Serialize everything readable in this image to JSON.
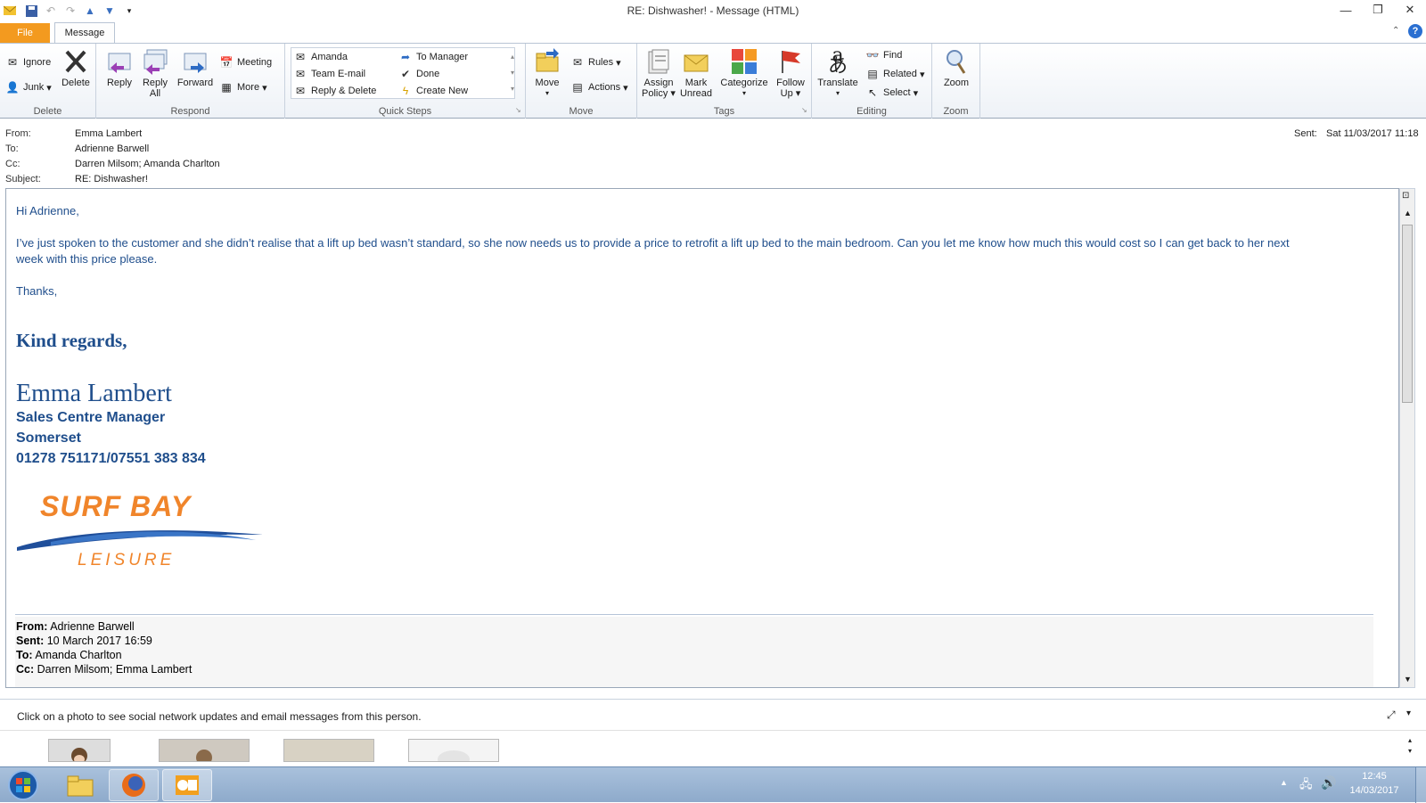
{
  "window": {
    "title": "RE: Dishwasher!  -  Message (HTML)"
  },
  "tabs": {
    "file": "File",
    "message": "Message"
  },
  "ribbon": {
    "delete_group": {
      "label": "Delete",
      "ignore": "Ignore",
      "junk": "Junk",
      "delete": "Delete"
    },
    "respond_group": {
      "label": "Respond",
      "reply": "Reply",
      "reply_all_1": "Reply",
      "reply_all_2": "All",
      "forward": "Forward",
      "meeting": "Meeting",
      "more": "More"
    },
    "quicksteps_group": {
      "label": "Quick Steps",
      "items": [
        "Amanda",
        "Team E-mail",
        "Reply & Delete",
        "To Manager",
        "Done",
        "Create New"
      ]
    },
    "move_group": {
      "label": "Move",
      "move": "Move",
      "rules": "Rules",
      "actions": "Actions"
    },
    "tags_group": {
      "label": "Tags",
      "assign_1": "Assign",
      "assign_2": "Policy",
      "mark_1": "Mark",
      "mark_2": "Unread",
      "categorize": "Categorize",
      "follow_1": "Follow",
      "follow_2": "Up"
    },
    "editing_group": {
      "label": "Editing",
      "translate": "Translate",
      "find": "Find",
      "related": "Related",
      "select": "Select"
    },
    "zoom_group": {
      "label": "Zoom",
      "zoom": "Zoom"
    }
  },
  "header": {
    "from_label": "From:",
    "from": "Emma Lambert",
    "to_label": "To:",
    "to": "Adrienne Barwell",
    "cc_label": "Cc:",
    "cc": "Darren Milsom; Amanda Charlton",
    "subject_label": "Subject:",
    "subject": "RE: Dishwasher!",
    "sent_label": "Sent:",
    "sent": "Sat 11/03/2017 11:18"
  },
  "body": {
    "greeting": "Hi Adrienne,",
    "para_line1": "I’ve just spoken to the customer and she didn’t realise that a lift up bed wasn’t standard, so she now needs us to provide a price to retrofit a lift up bed to the main bedroom. Can you let me know how much this would cost so I can get back to her next",
    "para_line2": "week with this price please.",
    "thanks": "Thanks,",
    "regards": "Kind regards,",
    "sig_name": "Emma Lambert",
    "sig_title": "Sales Centre Manager",
    "sig_location": "Somerset",
    "sig_phone": "01278 751171/07551 383 834",
    "logo_line1": "SURF BAY",
    "logo_line2": "LEISURE"
  },
  "forwarded": {
    "from_label": "From:",
    "from": "Adrienne Barwell",
    "sent_label": "Sent:",
    "sent": "10 March 2017 16:59",
    "to_label": "To:",
    "to": "Amanda Charlton",
    "cc_label": "Cc:",
    "cc": "Darren Milsom; Emma Lambert"
  },
  "social": {
    "hint": "Click on a photo to see social network updates and email messages from this person."
  },
  "taskbar": {
    "time": "12:45",
    "date": "14/03/2017"
  },
  "colors": {
    "accent_orange": "#f39a1f",
    "body_blue": "#1f4e8c",
    "logo_orange": "#f0852b"
  }
}
